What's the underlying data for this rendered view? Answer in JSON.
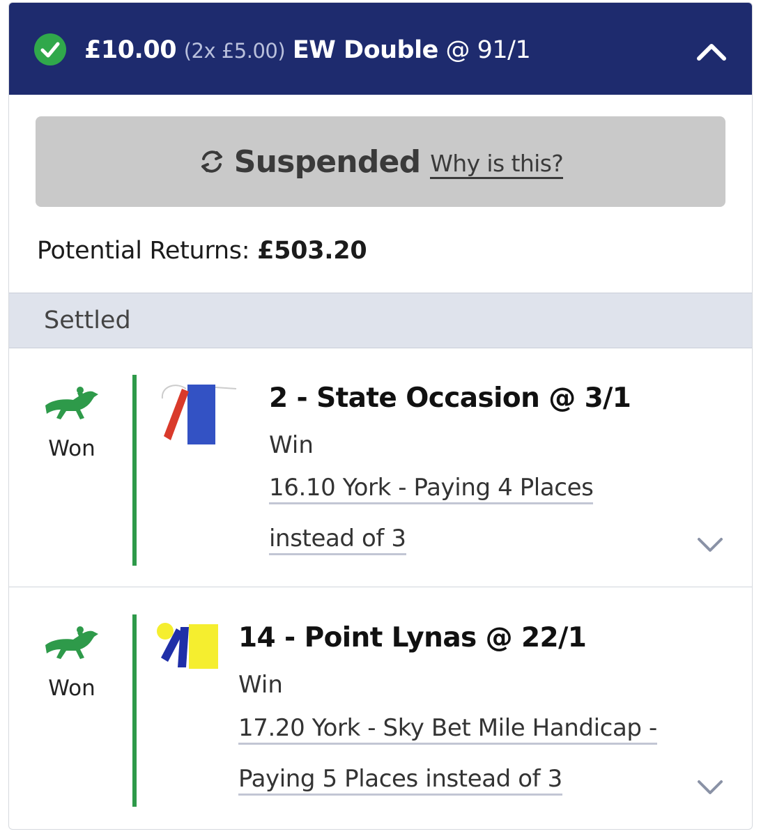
{
  "header": {
    "stake": "£10.00",
    "split": "(2x £5.00)",
    "bet_type": "EW Double",
    "odds": "@ 91/1",
    "status_icon": "check-circle-icon",
    "collapse_icon": "chevron-up-icon"
  },
  "suspended": {
    "icon": "refresh-icon",
    "label": "Suspended",
    "link": "Why is this?"
  },
  "returns": {
    "label": "Potential Returns:",
    "value": "£503.20"
  },
  "section": {
    "label": "Settled"
  },
  "selections": [
    {
      "result": "Won",
      "title": "2 - State Occasion @ 3/1",
      "market": "Win",
      "event_line1": "16.10 York - Paying 4 Places",
      "event_line2": "instead of 3",
      "silks_colors": [
        "#d93a2b",
        "#3352c4"
      ]
    },
    {
      "result": "Won",
      "title": "14 - Point Lynas @ 22/1",
      "market": "Win",
      "event_line1": "17.20 York - Sky Bet Mile Handicap -",
      "event_line2": "Paying 5 Places instead of 3",
      "silks_colors": [
        "#f5ee2f",
        "#1f2fa8"
      ]
    }
  ],
  "colors": {
    "header_bg": "#1e2b6e",
    "won_green": "#2e9a4a",
    "suspended_bg": "#c9c9c9"
  }
}
